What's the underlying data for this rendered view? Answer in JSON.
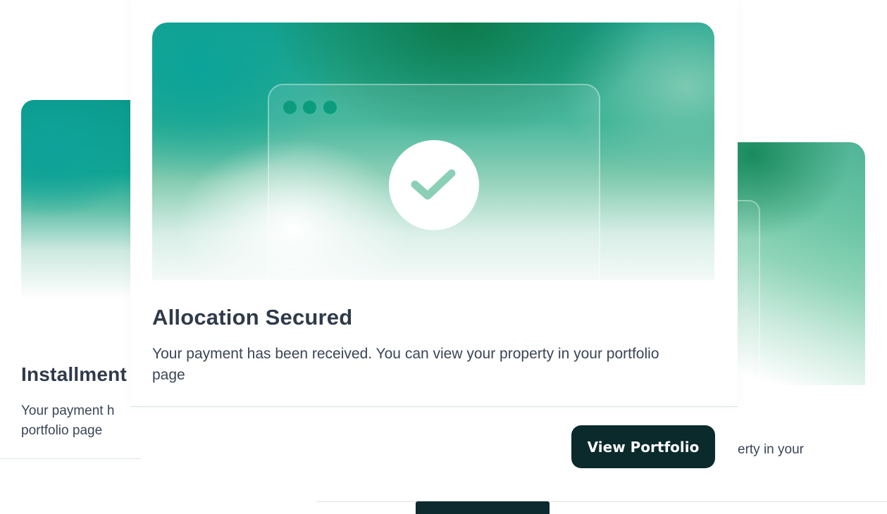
{
  "cards": {
    "left": {
      "title": "Installment",
      "description": "Your payment h portfolio page"
    },
    "center": {
      "title": "Allocation Secured",
      "description": "Your payment has been received. You can view your property in your portfolio page",
      "button_label": "View Portfolio"
    },
    "right": {
      "description": "erty in your"
    }
  },
  "icons": {
    "window_dots": "window-dots-icon",
    "check": "checkmark-icon"
  },
  "colors": {
    "button_bg": "#0a2a2c",
    "title_text": "#2f3a4a",
    "body_text": "#3a4556",
    "accent_teal": "#0b9c7d",
    "check_mark": "#8bd0b6"
  }
}
